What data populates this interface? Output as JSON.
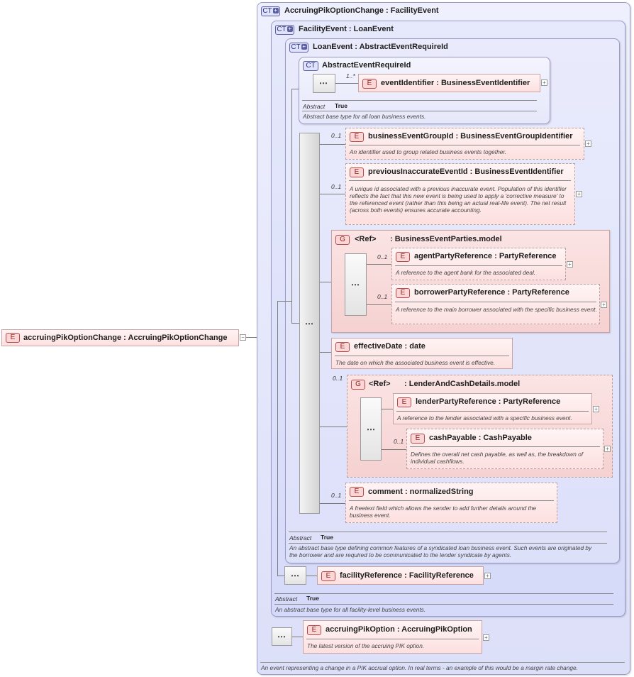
{
  "root": {
    "badge": "E",
    "name": "accruingPikOptionChange : AccruingPikOptionChange"
  },
  "ct_outer": {
    "badge": "CT",
    "name": "AccruingPikOptionChange : FacilityEvent",
    "doc": "An event representing a change in a PIK accrual option. In real terms - an example of this would be a margin rate change."
  },
  "ct_facility": {
    "badge": "CT",
    "name": "FacilityEvent : LoanEvent",
    "abstract_key": "Abstract",
    "abstract_val": "True",
    "doc": "An abstract base type for all facility-level business events."
  },
  "ct_loan": {
    "badge": "CT",
    "name": "LoanEvent : AbstractEventRequireId",
    "abstract_key": "Abstract",
    "abstract_val": "True",
    "doc": "An abstract base type defining common features of a syndicated loan business event. Such events are originated by the borrower and are required to be communicated to the lender syndicate by agents."
  },
  "ct_abstract": {
    "badge": "CT",
    "name": "AbstractEventRequireId",
    "abstract_key": "Abstract",
    "abstract_val": "True",
    "doc": "Abstract base type for all loan business events.",
    "event_identifier": {
      "badge": "E",
      "name": "eventIdentifier : BusinessEventIdentifier",
      "occurs": "1..*"
    }
  },
  "elements": {
    "business_event_group_id": {
      "badge": "E",
      "name": "businessEventGroupId : BusinessEventGroupIdentifier",
      "occurs": "0..1",
      "doc": "An identifier used to group related business events together."
    },
    "previous_inaccurate_event_id": {
      "badge": "E",
      "name": "previousInaccurateEventId : BusinessEventIdentifier",
      "occurs": "0..1",
      "doc": "A unique id associated with a previous inaccurate event. Population of this identifier reflects the fact that this new event is being used to apply a 'corrective measure' to the referenced event (rather than this being an actual real-life event). The net result (across both events) ensures accurate accounting."
    },
    "business_event_parties": {
      "badge": "G",
      "ref": "<Ref>",
      "name": ": BusinessEventParties.model",
      "agent": {
        "badge": "E",
        "name": "agentPartyReference : PartyReference",
        "occurs": "0..1",
        "doc": "A reference to the agent bank for the associated deal."
      },
      "borrower": {
        "badge": "E",
        "name": "borrowerPartyReference : PartyReference",
        "occurs": "0..1",
        "doc": "A reference to the main borrower associated with the specific business event."
      }
    },
    "effective_date": {
      "badge": "E",
      "name": "effectiveDate : date",
      "doc": "The date on which the associated business event is effective."
    },
    "lender_and_cash": {
      "badge": "G",
      "ref": "<Ref>",
      "name": ": LenderAndCashDetails.model",
      "occurs": "0..1",
      "lender": {
        "badge": "E",
        "name": "lenderPartyReference : PartyReference",
        "doc": "A reference to the lender associated with a specific business event."
      },
      "cash": {
        "badge": "E",
        "name": "cashPayable : CashPayable",
        "occurs": "0..1",
        "doc": "Defines the overall net cash payable, as well as, the breakdown of individual cashflows."
      }
    },
    "comment": {
      "badge": "E",
      "name": "comment : normalizedString",
      "occurs": "0..1",
      "doc": "A freetext field which allows the sender to add further details around the business event."
    },
    "facility_reference": {
      "badge": "E",
      "name": "facilityReference : FacilityReference"
    },
    "accruing_pik_option": {
      "badge": "E",
      "name": "accruingPikOption : AccruingPikOption",
      "doc": "The latest version of the accruing PIK option."
    }
  },
  "icons": {
    "sequence": "sequence-icon",
    "expand": "expand-plus-icon",
    "collapse": "collapse-minus-icon"
  },
  "colors": {
    "ct_fill": "#dcdff8",
    "element_fill": "#fde0e0",
    "sequence_fill": "#e4e4e4"
  }
}
